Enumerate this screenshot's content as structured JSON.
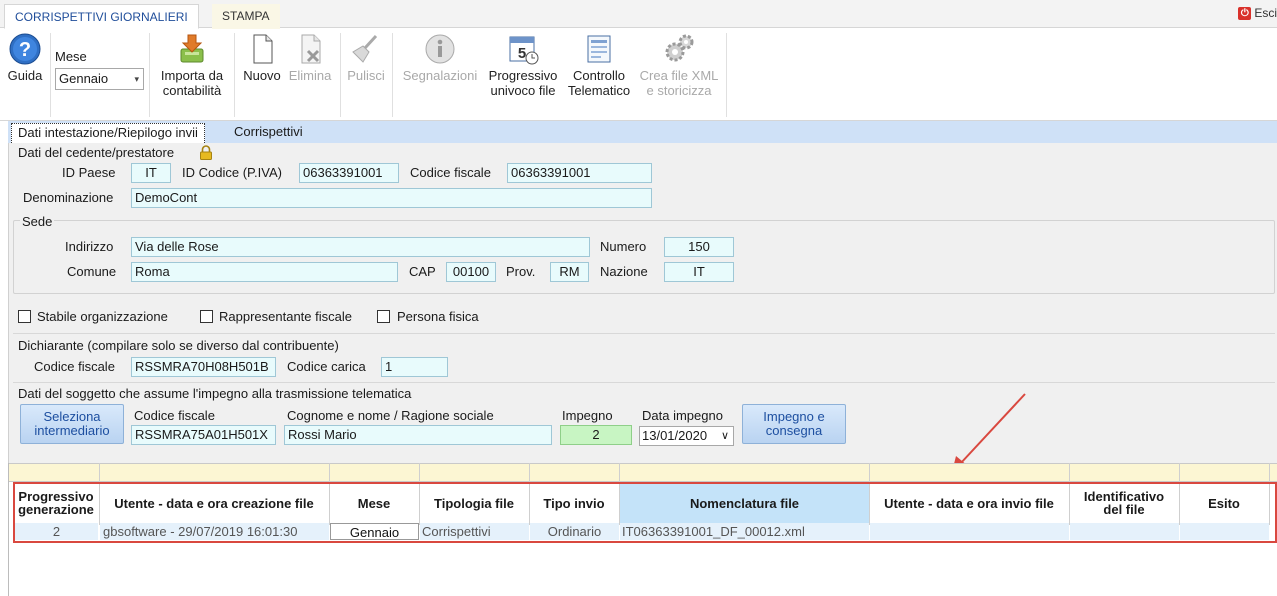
{
  "ribbon_tabs": [
    "CORRISPETTIVI GIORNALIERI",
    "STAMPA"
  ],
  "exit_label": "Esci",
  "toolbar": {
    "help_label": "Guida",
    "month_label": "Mese",
    "month_value": "Gennaio",
    "import_label_1": "Importa da",
    "import_label_2": "contabilità",
    "new_label": "Nuovo",
    "delete_label": "Elimina",
    "clean_label": "Pulisci",
    "reports_label": "Segnalazioni",
    "progressive_label_1": "Progressivo",
    "progressive_label_2": "univoco file",
    "check_label_1": "Controllo",
    "check_label_2": "Telematico",
    "xml_label_1": "Crea file XML",
    "xml_label_2": "e storicizza",
    "calendar_day": "5"
  },
  "inner_tabs": [
    "Dati intestazione/Riepilogo invii",
    "Corrispettivi"
  ],
  "cedente": {
    "section_title": "Dati del cedente/prestatore",
    "id_paese_label": "ID Paese",
    "id_paese": "IT",
    "id_codice_label": "ID Codice (P.IVA)",
    "id_codice": "06363391001",
    "codice_fiscale_label": "Codice fiscale",
    "codice_fiscale": "06363391001",
    "denominazione_label": "Denominazione",
    "denominazione": "DemoCont"
  },
  "sede": {
    "title": "Sede",
    "indirizzo_label": "Indirizzo",
    "indirizzo": "Via delle Rose",
    "numero_label": "Numero",
    "numero": "150",
    "comune_label": "Comune",
    "comune": "Roma",
    "cap_label": "CAP",
    "cap": "00100",
    "prov_label": "Prov.",
    "prov": "RM",
    "nazione_label": "Nazione",
    "nazione": "IT"
  },
  "checkboxes": {
    "stabile": "Stabile organizzazione",
    "rappresentante": "Rappresentante fiscale",
    "persona": "Persona fisica"
  },
  "dichiarante": {
    "title": "Dichiarante (compilare solo se diverso dal contribuente)",
    "codice_fiscale_label": "Codice fiscale",
    "codice_fiscale": "RSSMRA70H08H501B",
    "codice_carica_label": "Codice carica",
    "codice_carica": "1"
  },
  "soggetto": {
    "title": "Dati del soggetto che assume l'impegno alla trasmissione telematica",
    "select_btn_1": "Seleziona",
    "select_btn_2": "intermediario",
    "codice_fiscale_label": "Codice fiscale",
    "codice_fiscale": "RSSMRA75A01H501X",
    "nome_label": "Cognome e nome / Ragione sociale",
    "nome": "Rossi Mario",
    "impegno_label": "Impegno",
    "impegno": "2",
    "data_label": "Data impegno",
    "data": "13/01/2020",
    "consegna_btn_1": "Impegno e",
    "consegna_btn_2": "consegna"
  },
  "grid": {
    "headers": [
      [
        "Progressivo",
        "generazione"
      ],
      [
        "Utente - data e ora creazione file"
      ],
      [
        "Mese"
      ],
      [
        "Tipologia file"
      ],
      [
        "Tipo invio"
      ],
      [
        "Nomenclatura file"
      ],
      [
        "Utente - data e ora invio file"
      ],
      [
        "Identificativo",
        "del file"
      ],
      [
        "Esito"
      ]
    ],
    "rows": [
      {
        "progressivo": "2",
        "utente_creazione": "gbsoftware - 29/07/2019 16:01:30",
        "mese": "Gennaio",
        "tipologia": "Corrispettivi",
        "tipo_invio": "Ordinario",
        "nomenclatura": "IT06363391001_DF_00012.xml",
        "utente_invio": "",
        "identificativo": "",
        "esito": ""
      }
    ]
  },
  "colors": {
    "field_bg": "#e8fbfc",
    "tab_strip": "#cfe1f7",
    "highlight_header": "#c4e3f9",
    "annotation_red": "#d9483f",
    "impegno_green": "#c8f5c3"
  },
  "icons": [
    "help-icon",
    "import-icon",
    "new-document-icon",
    "delete-document-icon",
    "broom-icon",
    "info-icon",
    "calendar-icon",
    "form-icon",
    "gears-icon",
    "lock-icon",
    "arrow-annotation"
  ]
}
